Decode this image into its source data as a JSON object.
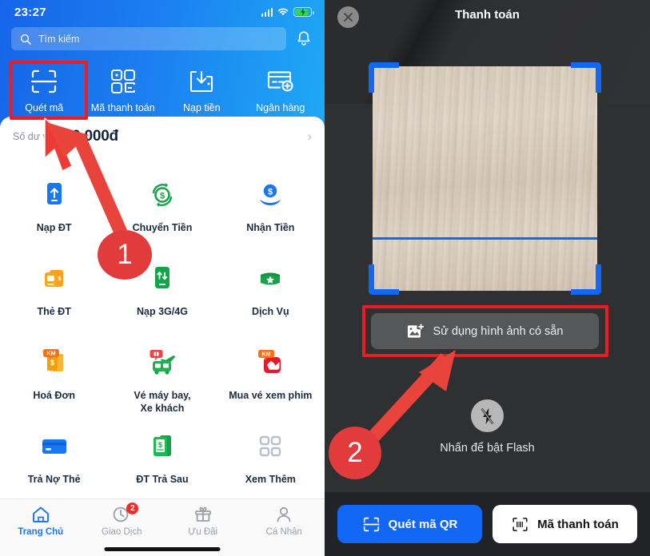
{
  "left": {
    "status": {
      "time": "23:27",
      "signal_icon": "cellular-signal-icon",
      "wifi_icon": "wifi-icon",
      "battery_icon": "battery-charging-icon"
    },
    "search": {
      "placeholder": "Tìm kiếm",
      "value": "",
      "icon": "search-icon"
    },
    "notification_icon": "bell-icon",
    "quick_actions": [
      {
        "label": "Quét mã",
        "icon": "scan-qr-icon",
        "highlighted": true
      },
      {
        "label": "Mã thanh toán",
        "icon": "payment-code-icon",
        "highlighted": false
      },
      {
        "label": "Nạp tiền",
        "icon": "wallet-topup-icon",
        "highlighted": false
      },
      {
        "label": "Ngân hàng",
        "icon": "bank-card-add-icon",
        "highlighted": false
      }
    ],
    "balance": {
      "label": "Số dư ví",
      "amount": "000.000đ",
      "chevron": "chevron-right-icon"
    },
    "services": [
      {
        "label": "Nạp ĐT",
        "icon": "phone-topup-icon"
      },
      {
        "label": "Chuyển Tiền",
        "icon": "money-transfer-icon"
      },
      {
        "label": "Nhận Tiền",
        "icon": "receive-money-icon"
      },
      {
        "label": "Thẻ ĐT",
        "icon": "phone-card-icon"
      },
      {
        "label": "Nạp 3G/4G",
        "icon": "data-topup-icon"
      },
      {
        "label": "Dịch Vụ",
        "icon": "services-icon"
      },
      {
        "label": "Hoá Đơn",
        "icon": "bill-icon",
        "promo": "KM"
      },
      {
        "label": "Vé máy bay,\nXe khách",
        "icon": "travel-ticket-icon"
      },
      {
        "label": "Mua vé xem phim",
        "icon": "movie-ticket-icon",
        "promo": "KM"
      },
      {
        "label": "Trả Nợ Thẻ",
        "icon": "credit-card-repay-icon"
      },
      {
        "label": "ĐT Trả Sau",
        "icon": "postpaid-phone-icon"
      },
      {
        "label": "Xem Thêm",
        "icon": "more-grid-icon"
      }
    ],
    "tabs": [
      {
        "label": "Trang Chủ",
        "icon": "home-icon",
        "active": true,
        "badge": ""
      },
      {
        "label": "Giao Dịch",
        "icon": "history-clock-icon",
        "active": false,
        "badge": "2"
      },
      {
        "label": "Ưu Đãi",
        "icon": "gift-icon",
        "active": false,
        "badge": ""
      },
      {
        "label": "Cá Nhân",
        "icon": "person-icon",
        "active": false,
        "badge": ""
      }
    ]
  },
  "right": {
    "title": "Thanh toán",
    "close_icon": "close-circle-icon",
    "scanner": {
      "corner_icon": "scan-corner-bracket",
      "scanline_icon": "scan-line"
    },
    "gallery_button": {
      "label": "Sử dụng hình ảnh có sẵn",
      "icon": "add-image-icon",
      "highlighted": true
    },
    "flash": {
      "label": "Nhấn để bật Flash",
      "icon": "flash-off-icon"
    },
    "actions": [
      {
        "label": "Quét mã QR",
        "icon": "scan-qr-icon",
        "style": "primary"
      },
      {
        "label": "Mã thanh toán",
        "icon": "barcode-icon",
        "style": "secondary"
      }
    ]
  },
  "annotations": {
    "step1": "1",
    "step2": "2",
    "highlight_color": "#ec1c24",
    "arrow_color": "#e8443c",
    "cursor_icon": "mouse-pointer-icon"
  }
}
